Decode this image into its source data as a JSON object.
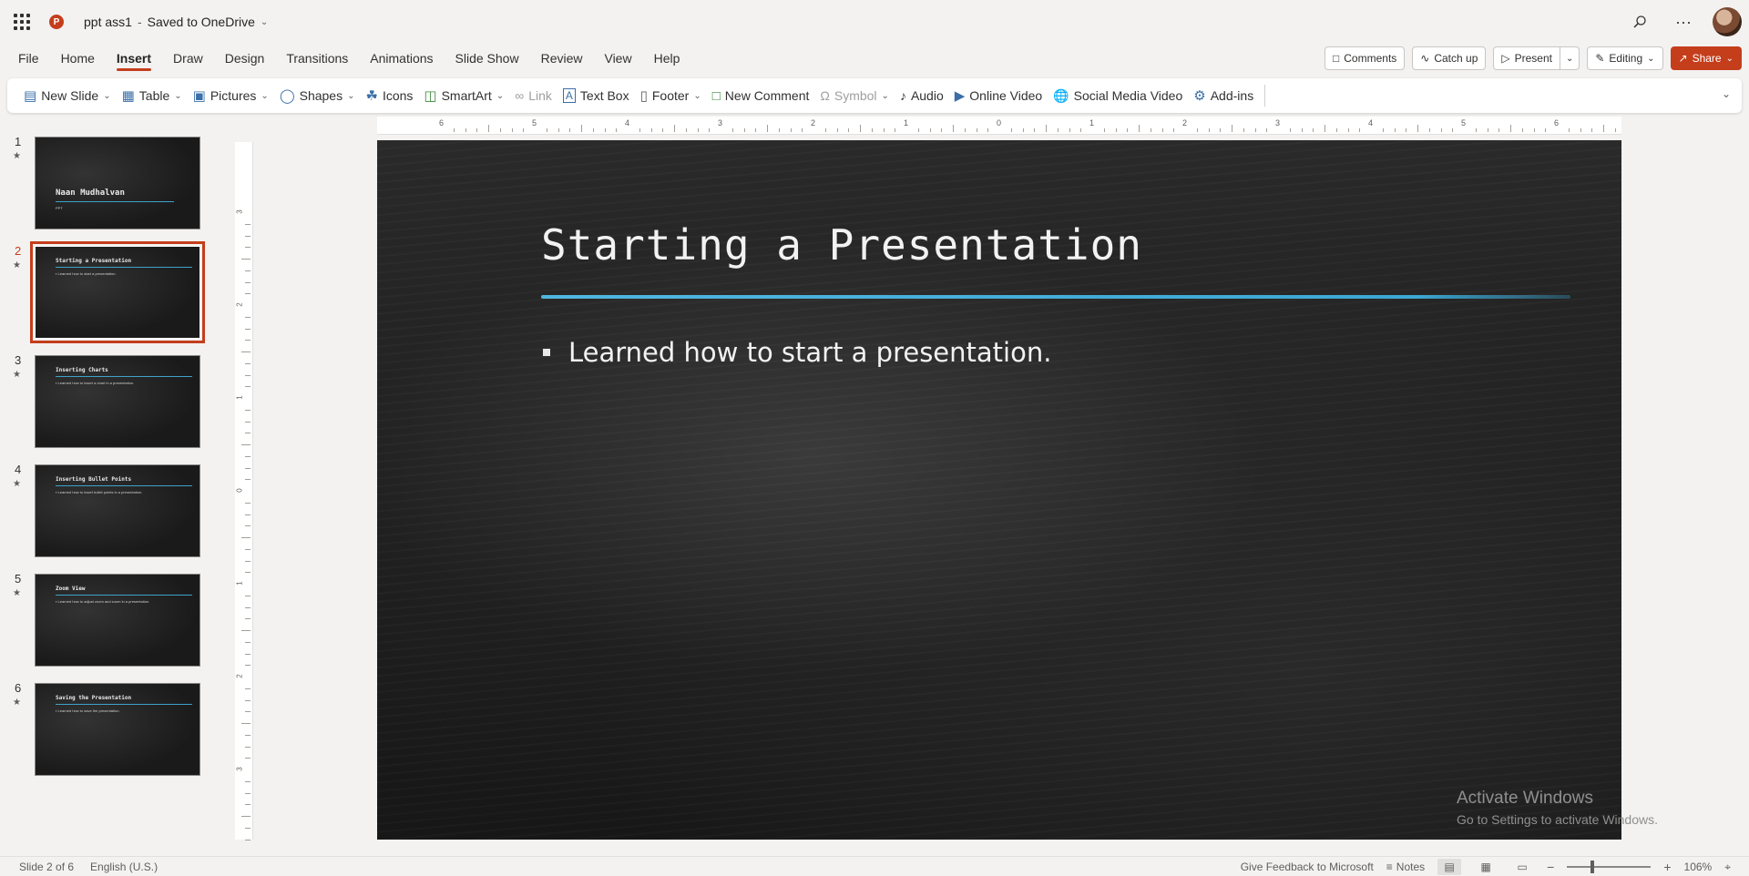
{
  "titlebar": {
    "doc_name": "ppt ass1",
    "separator": "-",
    "save_status": "Saved to OneDrive",
    "app_badge": "P"
  },
  "tabs": [
    {
      "label": "File"
    },
    {
      "label": "Home"
    },
    {
      "label": "Insert",
      "active": true
    },
    {
      "label": "Draw"
    },
    {
      "label": "Design"
    },
    {
      "label": "Transitions"
    },
    {
      "label": "Animations"
    },
    {
      "label": "Slide Show"
    },
    {
      "label": "Review"
    },
    {
      "label": "View"
    },
    {
      "label": "Help"
    }
  ],
  "actions": {
    "comments": "Comments",
    "catch_up": "Catch up",
    "present": "Present",
    "editing": "Editing",
    "share": "Share"
  },
  "ribbon": {
    "new_slide": "New Slide",
    "table": "Table",
    "pictures": "Pictures",
    "shapes": "Shapes",
    "icons": "Icons",
    "smartart": "SmartArt",
    "link": "Link",
    "text_box": "Text Box",
    "footer": "Footer",
    "new_comment": "New Comment",
    "symbol": "Symbol",
    "audio": "Audio",
    "online_video": "Online Video",
    "social_media_video": "Social Media Video",
    "add_ins": "Add-ins"
  },
  "slides": [
    {
      "num": "1",
      "title": "Naan Mudhalvan",
      "sub": "PPT"
    },
    {
      "num": "2",
      "title": "Starting a Presentation",
      "sub": "▪ Learned how to start a presentation."
    },
    {
      "num": "3",
      "title": "Inserting Charts",
      "sub": "▪ Learned how to insert a chart in a presentation."
    },
    {
      "num": "4",
      "title": "Inserting Bullet Points",
      "sub": "▪ Learned how to insert bullet points in a presentation."
    },
    {
      "num": "5",
      "title": "Zoom View",
      "sub": "▪ Learned how to adjust zoom and zoom in a presentation."
    },
    {
      "num": "6",
      "title": "Saving the Presentation",
      "sub": "▪ Learned how to save the presentation."
    }
  ],
  "current_slide": {
    "title": "Starting a Presentation",
    "bullet": "Learned how to start a presentation."
  },
  "watermark": {
    "line1": "Activate Windows",
    "line2": "Go to Settings to activate Windows."
  },
  "status": {
    "slide_pos": "Slide 2 of 6",
    "language": "English (U.S.)",
    "feedback": "Give Feedback to Microsoft",
    "notes": "Notes",
    "zoom": "106%"
  },
  "colors": {
    "accent": "#c43e1c",
    "slide_rule": "#3aa7d4"
  }
}
